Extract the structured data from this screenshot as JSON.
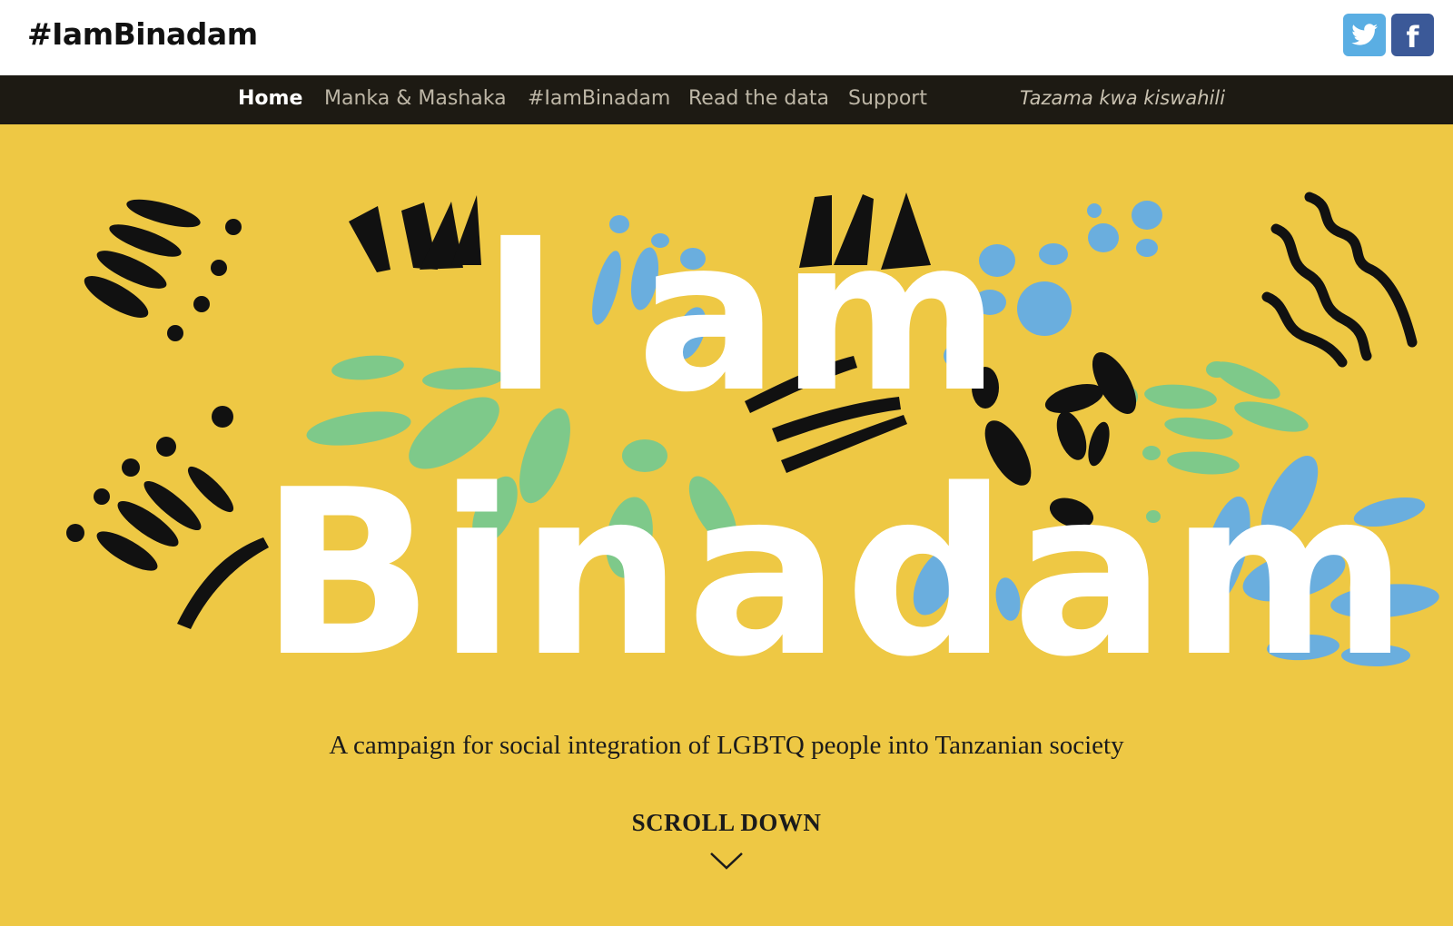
{
  "header": {
    "logo": "#IamBinadam",
    "social": {
      "twitter_icon": "twitter-icon",
      "facebook_icon": "facebook-icon",
      "facebook_glyph": "f"
    }
  },
  "nav": {
    "items": [
      {
        "label": "Home",
        "active": true
      },
      {
        "label": "Manka & Mashaka",
        "active": false
      },
      {
        "label": "#IamBinadam",
        "active": false
      },
      {
        "label": "Read the data",
        "active": false
      },
      {
        "label": "Support",
        "active": false
      }
    ],
    "language_link": "Tazama kwa kiswahili"
  },
  "hero": {
    "title_line1": "I am",
    "title_line2": "Binadam",
    "tagline": "A campaign for social integration of LGBTQ people into Tanzanian society",
    "scroll_label": "SCROLL DOWN"
  },
  "colors": {
    "hero_background": "#eec844",
    "nav_background": "#1d1a13",
    "twitter": "#5aaee3",
    "facebook": "#3b5998",
    "brush_black": "#111111",
    "brush_blue": "#6aaede",
    "brush_green": "#7ec98a"
  }
}
